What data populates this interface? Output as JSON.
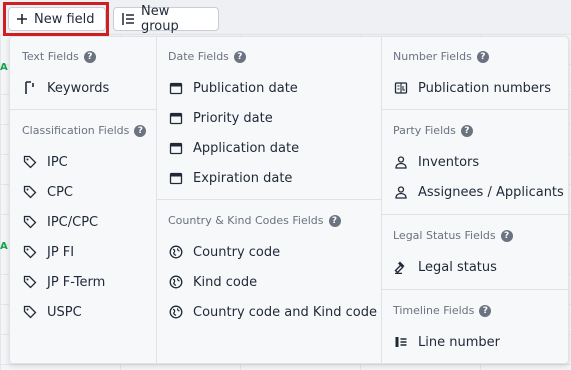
{
  "toolbar": {
    "new_field_label": "New field",
    "new_group_label": "New group"
  },
  "columns": {
    "text_fields": {
      "title": "Text Fields",
      "items": [
        {
          "label": "Keywords",
          "icon": "keyword-icon"
        }
      ]
    },
    "classification_fields": {
      "title": "Classification Fields",
      "items": [
        {
          "label": "IPC",
          "icon": "tag-icon"
        },
        {
          "label": "CPC",
          "icon": "tag-icon"
        },
        {
          "label": "IPC/CPC",
          "icon": "tag-icon"
        },
        {
          "label": "JP FI",
          "icon": "tag-icon"
        },
        {
          "label": "JP F-Term",
          "icon": "tag-icon"
        },
        {
          "label": "USPC",
          "icon": "tag-icon"
        }
      ]
    },
    "date_fields": {
      "title": "Date Fields",
      "items": [
        {
          "label": "Publication date",
          "icon": "calendar-icon"
        },
        {
          "label": "Priority date",
          "icon": "calendar-icon"
        },
        {
          "label": "Application date",
          "icon": "calendar-icon"
        },
        {
          "label": "Expiration date",
          "icon": "calendar-icon"
        }
      ]
    },
    "country_kind_fields": {
      "title": "Country & Kind Codes Fields",
      "items": [
        {
          "label": "Country code",
          "icon": "globe-icon"
        },
        {
          "label": "Kind code",
          "icon": "globe-icon"
        },
        {
          "label": "Country code and Kind code",
          "icon": "globe-icon"
        }
      ]
    },
    "number_fields": {
      "title": "Number Fields",
      "items": [
        {
          "label": "Publication numbers",
          "icon": "number-icon"
        }
      ]
    },
    "party_fields": {
      "title": "Party Fields",
      "items": [
        {
          "label": "Inventors",
          "icon": "person-icon"
        },
        {
          "label": "Assignees / Applicants",
          "icon": "person-icon"
        }
      ]
    },
    "legal_status_fields": {
      "title": "Legal Status Fields",
      "items": [
        {
          "label": "Legal status",
          "icon": "gavel-icon"
        }
      ]
    },
    "timeline_fields": {
      "title": "Timeline Fields",
      "items": [
        {
          "label": "Line number",
          "icon": "list-number-icon"
        }
      ]
    }
  },
  "colors": {
    "highlight": "#d11f1f",
    "accent_green": "#16a34a"
  }
}
